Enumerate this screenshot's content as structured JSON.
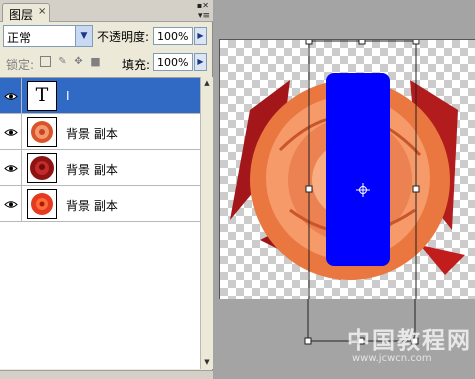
{
  "panel": {
    "tab_label": "图层",
    "tab_close": "×",
    "blend_mode": "正常",
    "opacity_label": "不透明度:",
    "opacity_value": "100%",
    "lock_label": "锁定:",
    "fill_label": "填充:",
    "fill_value": "100%"
  },
  "layers": [
    {
      "name": "I",
      "kind": "text",
      "selected": true,
      "thumb_glyph": "T"
    },
    {
      "name": "背景 副本",
      "kind": "image",
      "selected": false,
      "thumb": "rose-orange"
    },
    {
      "name": "背景 副本",
      "kind": "image",
      "selected": false,
      "thumb": "rose-red"
    },
    {
      "name": "背景 副本",
      "kind": "image",
      "selected": false,
      "thumb": "flower-red"
    }
  ],
  "colors": {
    "selection_blue": "#316ac5",
    "shape_blue": "#0000ff",
    "rose_orange": "#f08a5c",
    "rose_red": "#b52020"
  },
  "watermark": {
    "text_cn": "中国教程网",
    "url": "www.jcwcn.com"
  }
}
